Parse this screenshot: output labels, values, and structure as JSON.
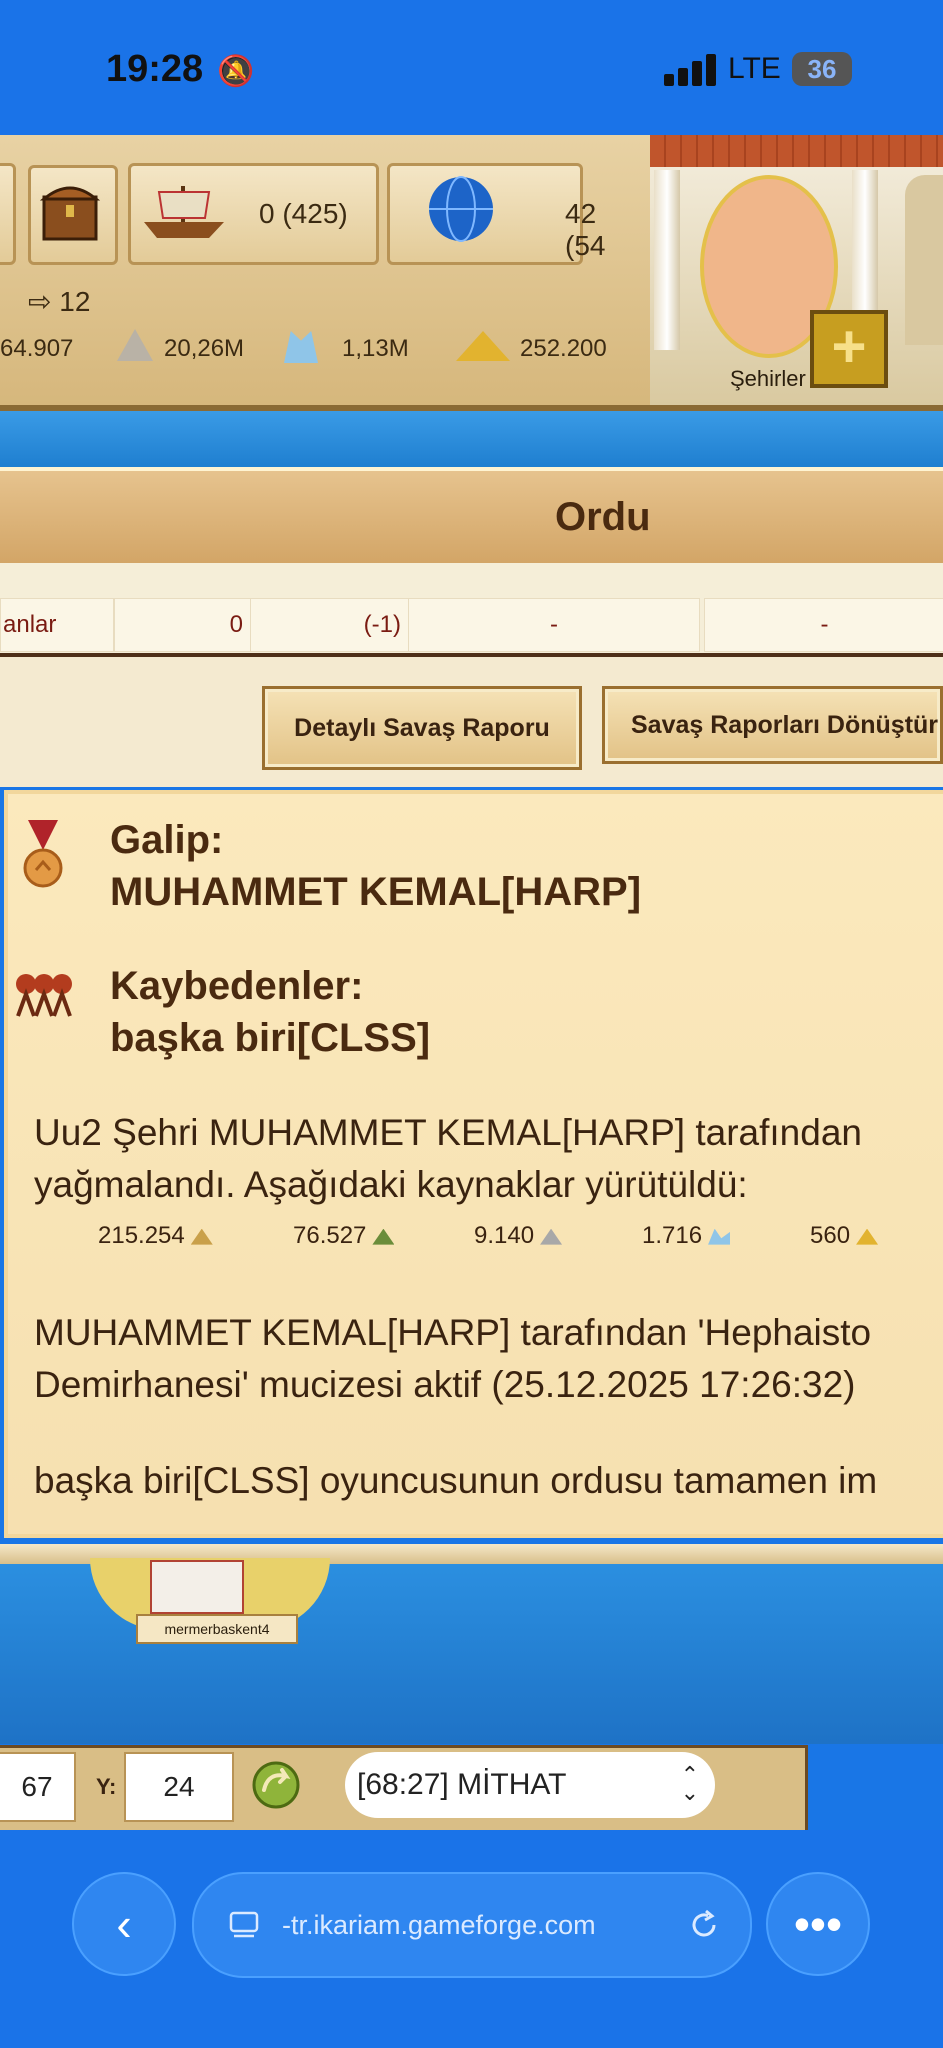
{
  "status_bar": {
    "time": "19:28",
    "network": "LTE",
    "battery": "36"
  },
  "topbar": {
    "ships": "0 (425)",
    "globe_value": "42 (54",
    "arrow_value": "12",
    "resources": [
      "64.907",
      "20,26M",
      "1,13M",
      "252.200"
    ],
    "cities_label": "Şehirler"
  },
  "army": {
    "title": "Ordu",
    "row": {
      "name": "anlar",
      "count": "0",
      "diff": "(-1)",
      "c4": "-",
      "c5": "-"
    }
  },
  "buttons": {
    "detailed_report": "Detaylı Savaş Raporu",
    "convert_reports": "Savaş Raporları Dönüştür"
  },
  "report": {
    "winner_label": "Galip:",
    "winner_name": "MUHAMMET KEMAL[HARP]",
    "losers_label": "Kaybedenler:",
    "loser_name": "başka biri[CLSS]",
    "loot_line1": "Uu2 Şehri MUHAMMET KEMAL[HARP] tarafından",
    "loot_line2": "yağmalandı. Aşağıdaki kaynaklar yürütüldü:",
    "loot": [
      {
        "value": "215.254",
        "icon": "wood-icon",
        "color": "#c9a04a"
      },
      {
        "value": "76.527",
        "icon": "wine-icon",
        "color": "#6b8d3a"
      },
      {
        "value": "9.140",
        "icon": "marble-icon",
        "color": "#a8a8a8"
      },
      {
        "value": "1.716",
        "icon": "crystal-icon",
        "color": "#8fc5e8"
      },
      {
        "value": "560",
        "icon": "sulfur-icon",
        "color": "#e2b32f"
      }
    ],
    "wonder_line1": "MUHAMMET KEMAL[HARP] tarafından 'Hephaisto",
    "wonder_line2": "Demirhanesi' mucizesi aktif (25.12.2025 17:26:32)",
    "army_line": "başka biri[CLSS] oyuncusunun ordusu tamamen im"
  },
  "map": {
    "city_label": "mermerbaskent4"
  },
  "coords": {
    "x": "67",
    "y_label": "Y:",
    "y": "24",
    "city_select": "[68:27] MİTHAT"
  },
  "browser": {
    "url": "-tr.ikariam.gameforge.com"
  }
}
